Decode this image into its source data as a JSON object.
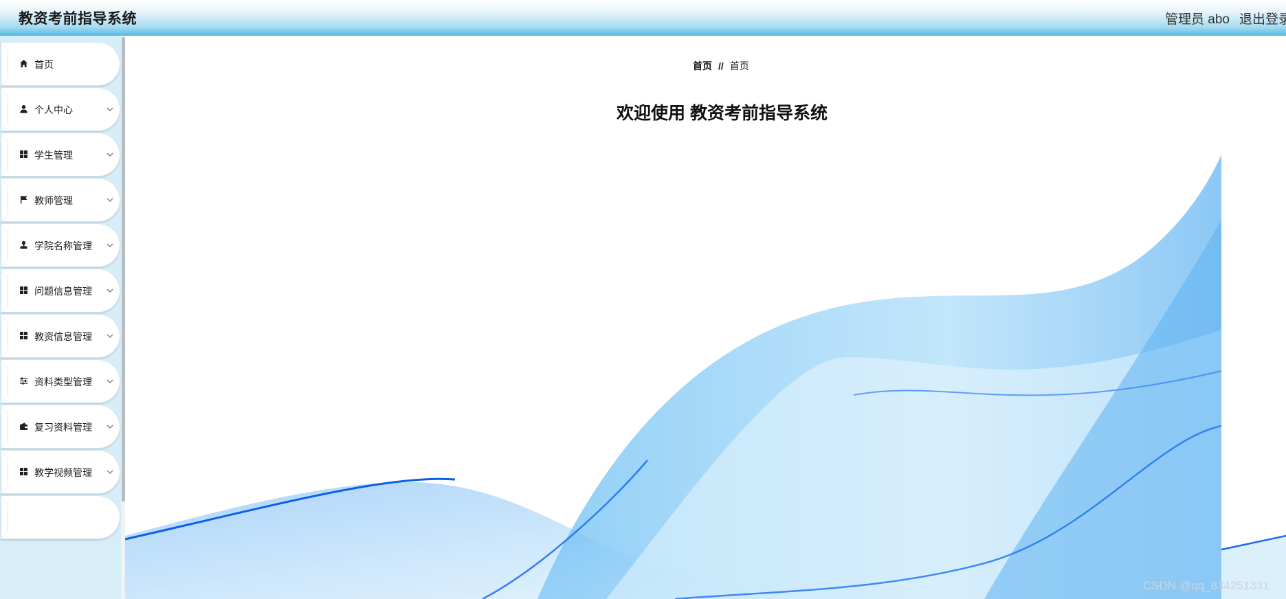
{
  "header": {
    "title": "教资考前指导系统",
    "user": "管理员 abo",
    "logout_label": "退出登录"
  },
  "sidebar": {
    "items": [
      {
        "label": "首页",
        "icon": "home-icon",
        "has_submenu": false
      },
      {
        "label": "个人中心",
        "icon": "user-icon",
        "has_submenu": true
      },
      {
        "label": "学生管理",
        "icon": "grid-icon",
        "has_submenu": true
      },
      {
        "label": "教师管理",
        "icon": "flag-icon",
        "has_submenu": true
      },
      {
        "label": "学院名称管理",
        "icon": "stamp-icon",
        "has_submenu": true
      },
      {
        "label": "问题信息管理",
        "icon": "grid-icon",
        "has_submenu": true
      },
      {
        "label": "教资信息管理",
        "icon": "grid-icon",
        "has_submenu": true
      },
      {
        "label": "资料类型管理",
        "icon": "sliders-icon",
        "has_submenu": true
      },
      {
        "label": "复习资料管理",
        "icon": "wallet-icon",
        "has_submenu": true
      },
      {
        "label": "教学视频管理",
        "icon": "grid-icon",
        "has_submenu": true
      }
    ]
  },
  "main": {
    "breadcrumb": {
      "home": "首页",
      "separator": "//",
      "current": "首页"
    },
    "welcome": "欢迎使用 教资考前指导系统"
  },
  "watermark": "CSDN @qq_834251331",
  "colors": {
    "header_gradient_end": "#52b7e2",
    "sidebar_bg": "#d7edf7",
    "wave_deep": "#0a5ee8",
    "wave_light": "#8fd0f7"
  }
}
